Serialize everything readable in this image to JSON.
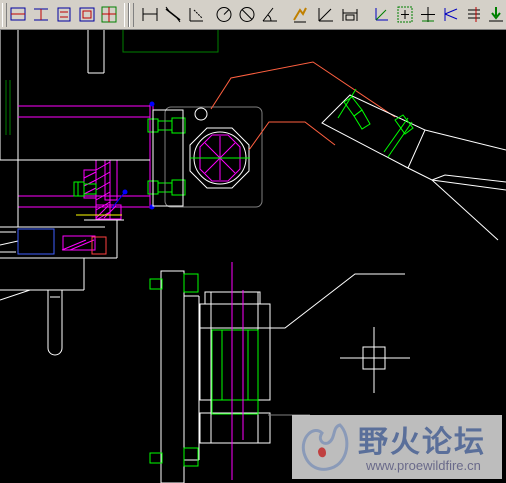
{
  "toolbar": {
    "groups": [
      {
        "name": "group-1",
        "tools": [
          "dimension-tool-icon",
          "dimension-tool-icon",
          "dimension-tool-icon",
          "dimension-tool-icon",
          "dimension-tool-icon"
        ]
      },
      {
        "name": "group-2",
        "tools": [
          "linear-dimension-icon",
          "aligned-dimension-icon",
          "ordinate-dimension-icon",
          "radius-dimension-icon",
          "diameter-dimension-icon",
          "angular-dimension-icon"
        ]
      },
      {
        "name": "group-3",
        "tools": [
          "quick-dimension-icon",
          "baseline-dimension-icon",
          "continue-dimension-icon"
        ]
      },
      {
        "name": "group-4",
        "tools": [
          "qleader-icon",
          "tolerance-icon",
          "center-mark-icon",
          "dimension-edit-icon",
          "dimension-text-edit-icon",
          "dimension-update-icon"
        ]
      }
    ]
  },
  "colors": {
    "toolbar_bg": "#d4d0c8",
    "canvas_bg": "#000000",
    "white_lines": "#ffffff",
    "magenta": "#ff00ff",
    "green": "#00ff00",
    "red_orange": "#ff6040",
    "blue": "#0000ff",
    "dark_green": "#008000",
    "yellow": "#ffff00"
  },
  "watermark": {
    "title": "野火论坛",
    "url": "www.proewildfire.cn"
  }
}
